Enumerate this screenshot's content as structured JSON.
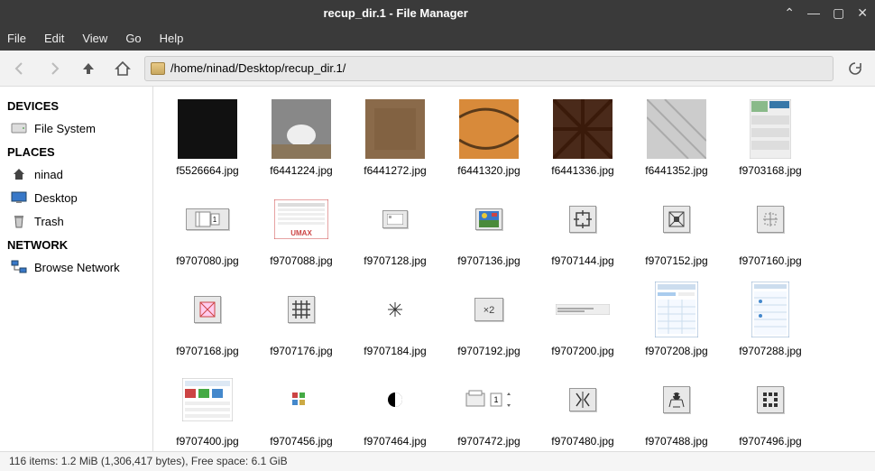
{
  "window": {
    "title": "recup_dir.1 - File Manager"
  },
  "menubar": {
    "file": "File",
    "edit": "Edit",
    "view": "View",
    "go": "Go",
    "help": "Help"
  },
  "location": {
    "path": "/home/ninad/Desktop/recup_dir.1/"
  },
  "sidebar": {
    "devices_hdr": "DEVICES",
    "devices": [
      {
        "label": "File System"
      }
    ],
    "places_hdr": "PLACES",
    "places": [
      {
        "label": "ninad"
      },
      {
        "label": "Desktop"
      },
      {
        "label": "Trash"
      }
    ],
    "network_hdr": "NETWORK",
    "network": [
      {
        "label": "Browse Network"
      }
    ]
  },
  "files": [
    {
      "name": "f5526664.jpg"
    },
    {
      "name": "f6441224.jpg"
    },
    {
      "name": "f6441272.jpg"
    },
    {
      "name": "f6441320.jpg"
    },
    {
      "name": "f6441336.jpg"
    },
    {
      "name": "f6441352.jpg"
    },
    {
      "name": "f9703168.jpg"
    },
    {
      "name": "f9707080.jpg"
    },
    {
      "name": "f9707088.jpg"
    },
    {
      "name": "f9707128.jpg"
    },
    {
      "name": "f9707136.jpg"
    },
    {
      "name": "f9707144.jpg"
    },
    {
      "name": "f9707152.jpg"
    },
    {
      "name": "f9707160.jpg"
    },
    {
      "name": "f9707168.jpg"
    },
    {
      "name": "f9707176.jpg"
    },
    {
      "name": "f9707184.jpg"
    },
    {
      "name": "f9707192.jpg"
    },
    {
      "name": "f9707200.jpg"
    },
    {
      "name": "f9707208.jpg"
    },
    {
      "name": "f9707288.jpg"
    },
    {
      "name": "f9707400.jpg"
    },
    {
      "name": "f9707456.jpg"
    },
    {
      "name": "f9707464.jpg"
    },
    {
      "name": "f9707472.jpg"
    },
    {
      "name": "f9707480.jpg"
    },
    {
      "name": "f9707488.jpg"
    },
    {
      "name": "f9707496.jpg"
    }
  ],
  "status": {
    "text": "116 items: 1.2 MiB (1,306,417 bytes), Free space: 6.1 GiB"
  }
}
